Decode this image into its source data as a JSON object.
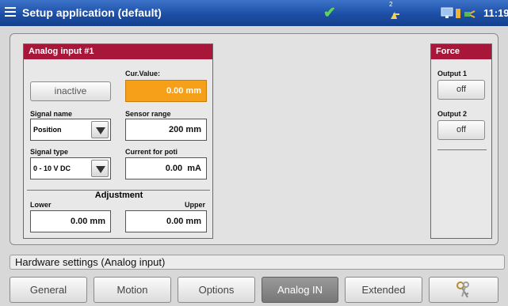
{
  "titlebar": {
    "title": "Setup application (default)",
    "status_check": "✔",
    "network_label": "2",
    "clock": "11:19",
    "accent": "#1d4fa6"
  },
  "analog_panel": {
    "header": "Analog input #1",
    "state_button": "inactive",
    "cur_value_label": "Cur.Value:",
    "cur_value": "0.00 mm",
    "signal_name_label": "Signal name",
    "signal_name_value": "Position",
    "sensor_range_label": "Sensor range",
    "sensor_range_value": "200 mm",
    "signal_type_label": "Signal type",
    "signal_type_value": "0 - 10 V DC",
    "current_poti_label": "Current for poti",
    "current_poti_value": "0.00  mA",
    "adjustment_title": "Adjustment",
    "lower_label": "Lower",
    "upper_label": "Upper",
    "lower_value": "0.00 mm",
    "upper_value": "0.00 mm",
    "header_color": "#a8173a",
    "value_highlight_color": "#f6a01a"
  },
  "force_panel": {
    "header": "Force",
    "output1_label": "Output 1",
    "output1_value": "off",
    "output2_label": "Output 2",
    "output2_value": "off"
  },
  "status_text": "Hardware settings (Analog input)",
  "tabs": [
    {
      "label": "General"
    },
    {
      "label": "Motion"
    },
    {
      "label": "Options"
    },
    {
      "label": "Analog IN"
    },
    {
      "label": "Extended"
    },
    {
      "label": "",
      "icon": "keys-icon"
    }
  ]
}
